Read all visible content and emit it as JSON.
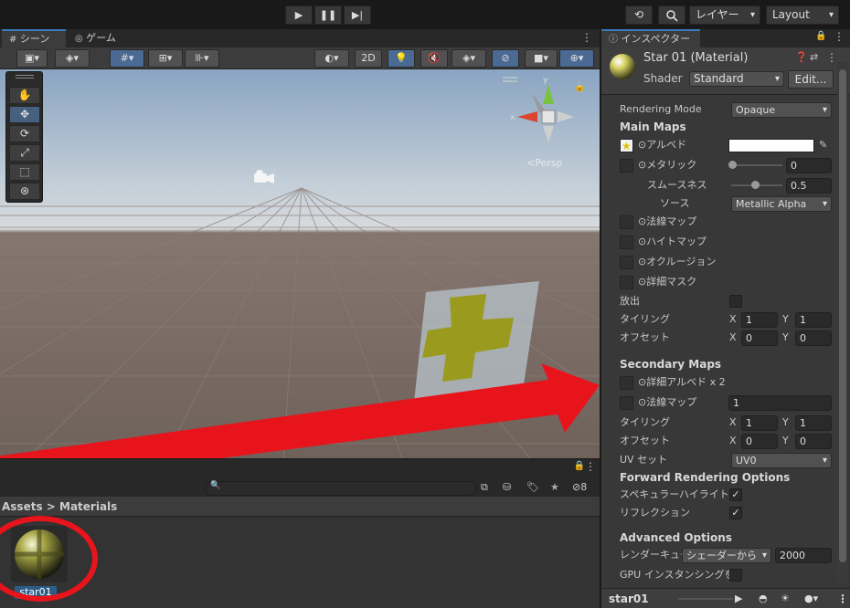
{
  "toolbar": {
    "play": "▶",
    "pause": "❚❚",
    "step": "▶|",
    "history": "⟲",
    "search": "🔍",
    "layers": "レイヤー",
    "layout": "Layout"
  },
  "scene": {
    "tabs": [
      "シーン",
      "ゲーム"
    ],
    "toolbar": {
      "mode_2d": "2D"
    },
    "persp_label": "<Persp"
  },
  "project": {
    "breadcrumb": "Assets > Materials",
    "asset_name": "star01",
    "hidden_count": "8"
  },
  "inspector": {
    "tab": "インスペクター",
    "material_name": "Star 01 (Material)",
    "shader_label": "Shader",
    "shader_value": "Standard",
    "edit_button": "Edit...",
    "rendering_mode_label": "Rendering Mode",
    "rendering_mode_value": "Opaque",
    "main_maps": "Main Maps",
    "albedo": "⊙アルベド",
    "metallic": "⊙メタリック",
    "metallic_value": "0",
    "smoothness": "スムースネス",
    "smoothness_value": "0.5",
    "source": "ソース",
    "source_value": "Metallic Alpha",
    "normal_map": "⊙法線マップ",
    "height_map": "⊙ハイトマップ",
    "occlusion": "⊙オクルージョン",
    "detail_mask": "⊙詳細マスク",
    "emission": "放出",
    "tiling": "タイリング",
    "offset": "オフセット",
    "x": "X",
    "y": "Y",
    "tiling_x": "1",
    "tiling_y": "1",
    "offset_x": "0",
    "offset_y": "0",
    "secondary_maps": "Secondary Maps",
    "detail_albedo": "⊙詳細アルベド x 2",
    "sec_normal_map": "⊙法線マップ",
    "sec_normal_value": "1",
    "sec_tiling_x": "1",
    "sec_tiling_y": "1",
    "sec_offset_x": "0",
    "sec_offset_y": "0",
    "uv_set": "UV セット",
    "uv_set_value": "UV0",
    "forward_options": "Forward Rendering Options",
    "specular_highlights": "スペキュラーハイライト",
    "reflections": "リフレクション",
    "advanced_options": "Advanced Options",
    "render_queue": "レンダーキュー",
    "render_queue_mode": "シェーダーから",
    "render_queue_value": "2000",
    "gpu_instancing": "GPU インスタンシングを有",
    "footer_name": "star01"
  },
  "colors": {
    "accent": "#3a79bb",
    "annotation": "#e8141c",
    "star": "#9a9a1e"
  }
}
